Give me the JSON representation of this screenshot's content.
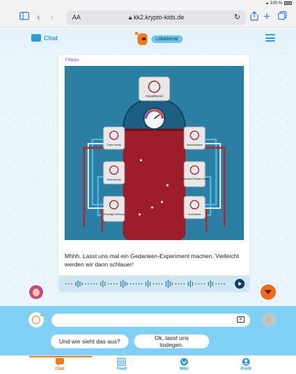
{
  "status_bar": {
    "battery": "100 %"
  },
  "browser": {
    "text_size": "AA",
    "url": "kk2.krypto-kids.de"
  },
  "header": {
    "chat_label": "Chat",
    "bot_name": "Labalama!"
  },
  "message": {
    "sender": "Filippa",
    "text": "Mhhh. Lasst uns mal ein Gedanken-Experiment machen. Vielleicht werden wir dann schlauer!",
    "illustration": {
      "top_label": "Gewaltbereit",
      "left_labels": [
        "Fake News",
        "Bedrohung",
        "Einseitige Meinung"
      ],
      "right_labels": [
        "Machtlosigkeit",
        "Schlechtes Familien-Klima",
        "Anschluss"
      ]
    }
  },
  "composer": {
    "input_value": "",
    "input_placeholder": "",
    "quick_replies": [
      "Und wie sieht das aus?",
      "Ok, lasst uns loslegen."
    ]
  },
  "tabs": [
    {
      "label": "Chat",
      "icon": "chat-icon",
      "color": "#f07b1f",
      "active": true
    },
    {
      "label": "Feed",
      "icon": "feed-icon",
      "color": "#2b9cd8",
      "active": false
    },
    {
      "label": "Wiki",
      "icon": "wiki-icon",
      "color": "#2b9cd8",
      "active": false
    },
    {
      "label": "Profil",
      "icon": "profile-icon",
      "color": "#2b9cd8",
      "active": false
    }
  ],
  "colors": {
    "accent_orange": "#f07b1f",
    "brand_blue": "#2b9cd8",
    "composer_bg": "#7fd0f2",
    "illustration_bg": "#2a7fa3",
    "illustration_body": "#9e1d2b"
  }
}
